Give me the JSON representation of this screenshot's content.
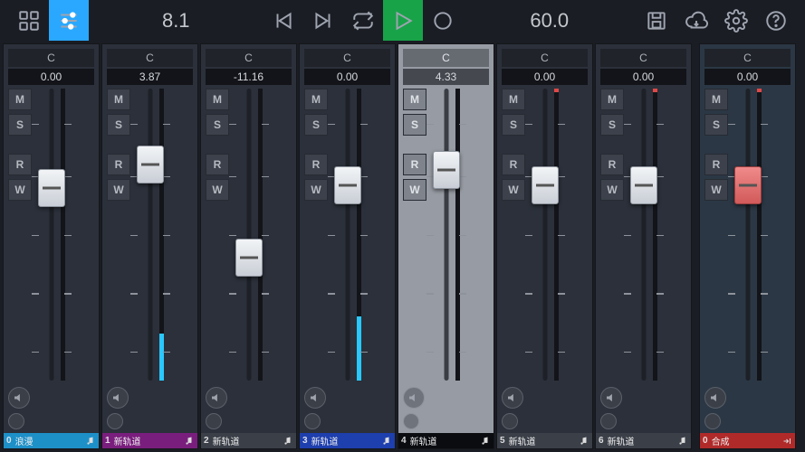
{
  "toolbar": {
    "value_left": "8.1",
    "value_right": "60.0"
  },
  "tracks": [
    {
      "idx": 0,
      "name": "浪漫",
      "pan": "C",
      "level": "0.00",
      "fader_pct": 66,
      "meter_pct": 0,
      "peak": false,
      "color": "#1e90c8",
      "selected": false
    },
    {
      "idx": 1,
      "name": "新轨道",
      "pan": "C",
      "level": "3.87",
      "fader_pct": 74,
      "meter_pct": 16,
      "peak": false,
      "color": "#7a1e7e",
      "selected": false
    },
    {
      "idx": 2,
      "name": "新轨道",
      "pan": "C",
      "level": "-11.16",
      "fader_pct": 42,
      "meter_pct": 0,
      "peak": false,
      "color": "#3a3f48",
      "selected": false
    },
    {
      "idx": 3,
      "name": "新轨道",
      "pan": "C",
      "level": "0.00",
      "fader_pct": 67,
      "meter_pct": 22,
      "peak": false,
      "color": "#1e3fae",
      "selected": false
    },
    {
      "idx": 4,
      "name": "新轨道",
      "pan": "C",
      "level": "4.33",
      "fader_pct": 72,
      "meter_pct": 0,
      "peak": false,
      "color": "#0a0c10",
      "selected": true
    },
    {
      "idx": 5,
      "name": "新轨道",
      "pan": "C",
      "level": "0.00",
      "fader_pct": 67,
      "meter_pct": 0,
      "peak": true,
      "color": "#3a3f48",
      "selected": false
    },
    {
      "idx": 6,
      "name": "新轨道",
      "pan": "C",
      "level": "0.00",
      "fader_pct": 67,
      "meter_pct": 0,
      "peak": true,
      "color": "#3a3f48",
      "selected": false
    }
  ],
  "master": {
    "idx": 0,
    "name": "合成",
    "pan": "C",
    "level": "0.00",
    "fader_pct": 67,
    "meter_pct": 0,
    "peak": true,
    "color": "#b02a2a"
  },
  "buttons": {
    "m": "M",
    "s": "S",
    "r": "R",
    "w": "W"
  },
  "icons": {
    "grid": "grid-icon",
    "sliders": "sliders-icon",
    "skip_back": "skip-back-icon",
    "skip_fwd": "skip-forward-icon",
    "loop": "loop-icon",
    "play": "play-icon",
    "record": "record-icon",
    "save": "save-icon",
    "cloud": "cloud-download-icon",
    "settings": "settings-icon",
    "help": "help-icon",
    "speaker": "speaker-icon",
    "knob": "knob-icon",
    "note": "music-note-icon",
    "out": "output-icon"
  }
}
